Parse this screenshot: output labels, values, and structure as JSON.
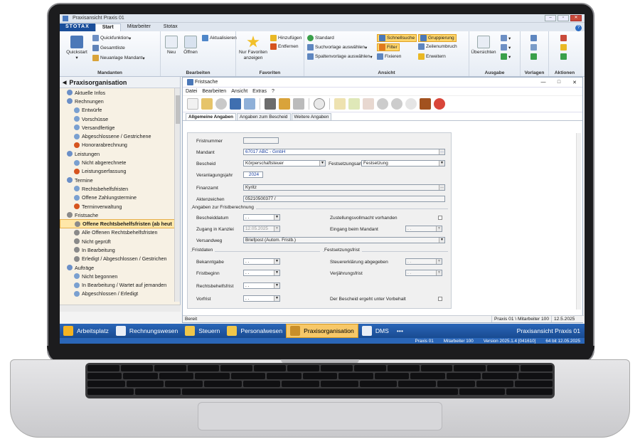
{
  "window": {
    "title": "Praxisansicht Praxis 01"
  },
  "ribbon": {
    "brand": "STOTAX",
    "tabs": [
      "Start",
      "Mitarbeiter",
      "Stotax"
    ],
    "groups": {
      "mandanten": {
        "label": "Mandanten",
        "quickstart": "Quickstart",
        "quickfunktion": "Quickfunktion",
        "gesamtliste": "Gesamtliste",
        "neuanlage": "Neuanlage Mandant"
      },
      "bearbeiten": {
        "label": "Bearbeiten",
        "neu": "Neu",
        "oeffnen": "Öffnen",
        "aktualisieren": "Aktualisieren"
      },
      "favoriten": {
        "label": "Favoriten",
        "nur_favoriten": "Nur Favoriten anzeigen",
        "hinzufuegen": "Hinzufügen",
        "entfernen": "Entfernen"
      },
      "ansicht": {
        "label": "Ansicht",
        "standard": "Standard",
        "suchvorlage": "Suchvorlage auswählen",
        "spaltenvorlage": "Spaltenvorlage auswählen",
        "schnellsuche": "Schnellsuche",
        "filter": "Filter",
        "fixieren": "Fixieren",
        "gruppierung": "Gruppierung",
        "zeilenumbruch": "Zeilenumbruch",
        "erweitern": "Erweitern"
      },
      "ausgabe": {
        "label": "Ausgabe",
        "uebersichten": "Übersichten"
      },
      "vorlagen": {
        "label": "Vorlagen"
      },
      "aktionen": {
        "label": "Aktionen"
      }
    }
  },
  "nav": {
    "title": "Praxisorganisation",
    "items": [
      {
        "label": "Aktuelle Infos",
        "indent": 1,
        "color": "#6b8fc7"
      },
      {
        "label": "Rechnungen",
        "indent": 1,
        "color": "#6b8fc7"
      },
      {
        "label": "Entwürfe",
        "indent": 2,
        "color": "#7aa0d0"
      },
      {
        "label": "Vorschüsse",
        "indent": 2,
        "color": "#7aa0d0"
      },
      {
        "label": "Versandfertige",
        "indent": 2,
        "color": "#7aa0d0"
      },
      {
        "label": "Abgeschlossene / Gestrichene",
        "indent": 2,
        "color": "#7aa0d0"
      },
      {
        "label": "Honorarabrechnung",
        "indent": 2,
        "color": "#d6541f"
      },
      {
        "label": "Leistungen",
        "indent": 1,
        "color": "#6b8fc7"
      },
      {
        "label": "Nicht abgerechnete",
        "indent": 2,
        "color": "#7aa0d0"
      },
      {
        "label": "Leistungserfassung",
        "indent": 2,
        "color": "#d6541f"
      },
      {
        "label": "Termine",
        "indent": 1,
        "color": "#6b8fc7"
      },
      {
        "label": "Rechtsbehelfsfristen",
        "indent": 2,
        "color": "#7aa0d0"
      },
      {
        "label": "Offene Zahlungstermine",
        "indent": 2,
        "color": "#7aa0d0"
      },
      {
        "label": "Terminverwaltung",
        "indent": 2,
        "color": "#d6541f"
      },
      {
        "label": "Fristsache",
        "indent": 1,
        "color": "#8a8a8a"
      },
      {
        "label": "Offene Rechtsbehelfsfristen (ab heut",
        "indent": 2,
        "color": "#8a8a8a",
        "selected": true
      },
      {
        "label": "Alle Offenen Rechtsbehelfsfristen",
        "indent": 2,
        "color": "#8a8a8a"
      },
      {
        "label": "Nicht geprüft",
        "indent": 2,
        "color": "#8a8a8a"
      },
      {
        "label": "In Bearbeitung",
        "indent": 2,
        "color": "#8a8a8a"
      },
      {
        "label": "Erledigt / Abgeschlossen / Gestrichen",
        "indent": 2,
        "color": "#8a8a8a"
      },
      {
        "label": "Aufträge",
        "indent": 1,
        "color": "#6b8fc7"
      },
      {
        "label": "Nicht begonnen",
        "indent": 2,
        "color": "#7aa0d0"
      },
      {
        "label": "In Bearbeitung / Wartet auf jemanden",
        "indent": 2,
        "color": "#7aa0d0"
      },
      {
        "label": "Abgeschlossen / Erledigt",
        "indent": 2,
        "color": "#7aa0d0"
      }
    ]
  },
  "doc": {
    "title": "Fristsache",
    "menu": [
      "Datei",
      "Bearbeiten",
      "Ansicht",
      "Extras",
      "?"
    ],
    "tabs": [
      "Allgemeine Angaben",
      "Angaben zum Bescheid",
      "Weitere Angaben"
    ],
    "form": {
      "fristnummer": {
        "label": "Fristnummer",
        "value": ""
      },
      "mandant": {
        "label": "Mandant",
        "value": "67017 ABC - GmbH"
      },
      "bescheid": {
        "label": "Bescheid",
        "value": "Körperschaftsteuer"
      },
      "festsetzungsart": {
        "label": "Festsetzungsart",
        "value": "Festsetzung"
      },
      "veranlagungsjahr": {
        "label": "Veranlagungsjahr",
        "value": "2024"
      },
      "finanzamt": {
        "label": "Finanzamt",
        "value": "Kyritz"
      },
      "aktenzeichen": {
        "label": "Aktenzeichen",
        "value": "05210500377 /"
      },
      "section_frist": "Angaben zur Fristberechnung",
      "bescheiddatum": {
        "label": "Bescheiddatum",
        "value": ". ."
      },
      "zugang": {
        "label": "Zugang in Kanzlei",
        "value": "12.05.2025"
      },
      "versandweg": {
        "label": "Versandweg",
        "value": "Briefpost (Autom. Fristb.)"
      },
      "zustellvollmacht": "Zustellungsvollmacht vorhanden",
      "eingang": {
        "label": "Eingang beim Mandant",
        "value": ". ."
      },
      "section_fristdaten": "Fristdaten",
      "section_festsetzung": "Festsetzungsfrist",
      "bekanntgabe": {
        "label": "Bekanntgabe",
        "value": ". ."
      },
      "fristbeginn": {
        "label": "Fristbeginn",
        "value": ". ."
      },
      "rechtsbehelfsfrist": {
        "label": "Rechtsbehelfsfrist",
        "value": ". ."
      },
      "vorfrist": {
        "label": "Vorfrist",
        "value": ". ."
      },
      "steuererklaerung": {
        "label": "Steuererklärung abgegeben",
        "value": ". ."
      },
      "verjaehrung": {
        "label": "Verjährungsfrist",
        "value": ". ."
      },
      "vorbehalt": "Der Bescheid ergeht unter Vorbehalt"
    },
    "status": {
      "left": "Bereit",
      "user": "Praxis 01 \\ Mitarbeiter 100",
      "date": "12.5.2025"
    }
  },
  "modules": {
    "items": [
      {
        "label": "Arbeitsplatz",
        "color": "#f4b321"
      },
      {
        "label": "Rechnungswesen",
        "color": "#e9eef6"
      },
      {
        "label": "Steuern",
        "color": "#f0c64a"
      },
      {
        "label": "Personalwesen",
        "color": "#f0c64a"
      },
      {
        "label": "Praxisorganisation",
        "color": "#c98f2a",
        "active": true
      },
      {
        "label": "DMS",
        "color": "#e9eef6"
      }
    ],
    "more": "•••",
    "right": "Praxisansicht Praxis 01"
  },
  "infobar": {
    "praxis": "Praxis 01",
    "mitarbeiter": "Mitarbeiter 100",
    "version": "Version 2025.1.4 [041610]",
    "bit": "64 bit 12.05.2025"
  }
}
